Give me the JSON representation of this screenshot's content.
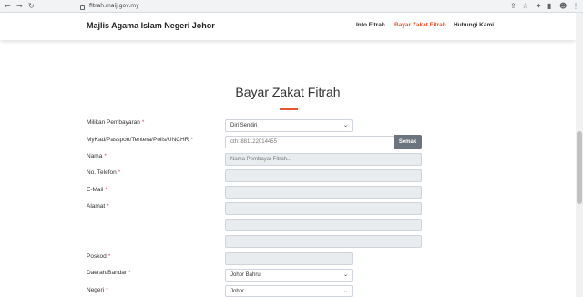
{
  "browser": {
    "back": "←",
    "forward": "→",
    "reload": "↻",
    "url": "fitrah.maij.gov.my",
    "controls": [
      "⇪",
      "☆",
      "✦",
      "▮",
      "☻",
      "⋮"
    ]
  },
  "header": {
    "brand": "Majlis Agama Islam Negeri Johor",
    "menu": [
      {
        "label": "Info Fitrah"
      },
      {
        "label": "Bayar Zakat Fitrah"
      },
      {
        "label": "Hubungi Kami"
      }
    ]
  },
  "accent_color": "#e4572e",
  "form": {
    "title": "Bayar Zakat Fitrah",
    "required_mark": "*",
    "fields": {
      "milikan": {
        "label": "Milikan Pembayaran",
        "value": "Diri Sendiri",
        "caret": "⌄"
      },
      "mykad": {
        "label": "MyKad/Passport/Tentera/Polis/UNCHR",
        "placeholder": "cth: 881122014455",
        "button": "Semak"
      },
      "nama": {
        "label": "Nama",
        "placeholder": "Nama Pembayar Fitrah..."
      },
      "telefon": {
        "label": "No. Telefon"
      },
      "email": {
        "label": "E-Mail"
      },
      "alamat": {
        "label": "Alamat"
      },
      "poskod": {
        "label": "Poskod"
      },
      "daerah": {
        "label": "Daerah/Bandar",
        "value": "Johor Bahru",
        "caret": "⌄"
      },
      "negeri": {
        "label": "Negeri",
        "value": "Johor",
        "caret": "⌄"
      }
    }
  }
}
